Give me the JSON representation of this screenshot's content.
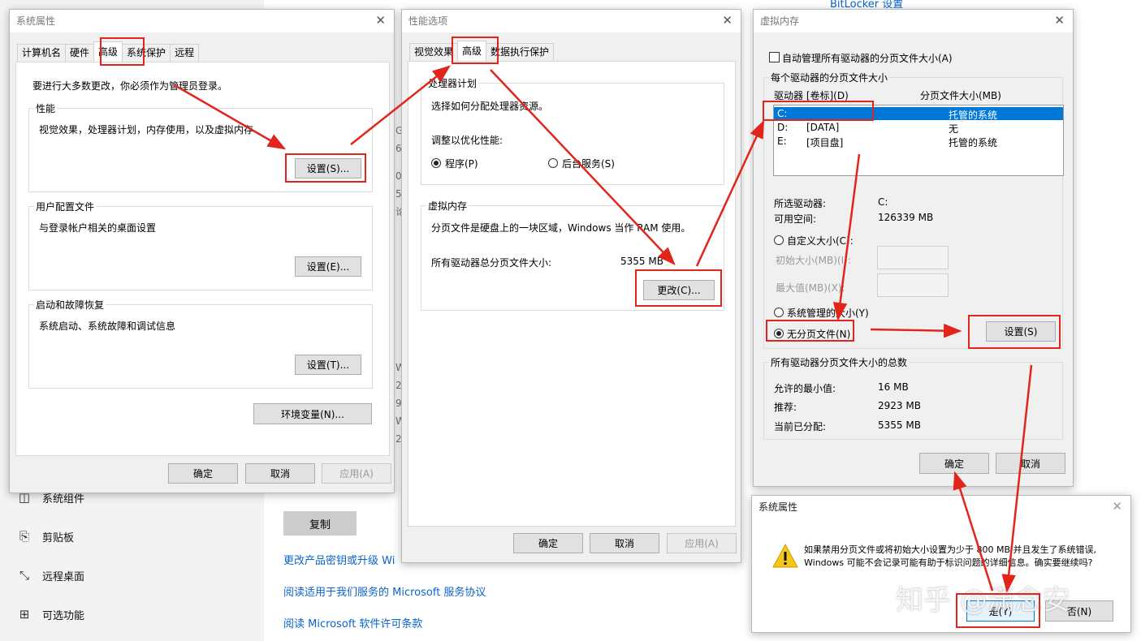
{
  "background": {
    "top_link": "BitLocker 设置",
    "side_items": [
      {
        "icon": "components-icon",
        "label": "系统组件"
      },
      {
        "icon": "clipboard-icon",
        "label": "剪贴板"
      },
      {
        "icon": "remote-desktop-icon",
        "label": "远程桌面"
      },
      {
        "icon": "optional-features-icon",
        "label": "可选功能"
      }
    ],
    "copy_button": "复制",
    "links": [
      "更改产品密钥或升级 Wi",
      "阅读适用于我们服务的 Microsoft 服务协议",
      "阅读 Microsoft 软件许可条款"
    ],
    "peek_chars": [
      "G",
      "6",
      "0",
      "5",
      "论",
      "W",
      "2",
      "9",
      "W",
      "2"
    ]
  },
  "sysprops": {
    "title": "系统属性",
    "tabs": [
      "计算机名",
      "硬件",
      "高级",
      "系统保护",
      "远程"
    ],
    "active_tab": "高级",
    "admin_note": "要进行大多数更改，你必须作为管理员登录。",
    "performance": {
      "label": "性能",
      "desc": "视觉效果，处理器计划，内存使用，以及虚拟内存",
      "button": "设置(S)..."
    },
    "user_profiles": {
      "label": "用户配置文件",
      "desc": "与登录帐户相关的桌面设置",
      "button": "设置(E)..."
    },
    "startup": {
      "label": "启动和故障恢复",
      "desc": "系统启动、系统故障和调试信息",
      "button": "设置(T)..."
    },
    "env_button": "环境变量(N)...",
    "ok": "确定",
    "cancel": "取消",
    "apply": "应用(A)"
  },
  "perf": {
    "title": "性能选项",
    "tabs": [
      "视觉效果",
      "高级",
      "数据执行保护"
    ],
    "active_tab": "高级",
    "cpu": {
      "label": "处理器计划",
      "desc": "选择如何分配处理器资源。",
      "adjust": "调整以优化性能:",
      "programs": "程序(P)",
      "services": "后台服务(S)"
    },
    "vm": {
      "label": "虚拟内存",
      "desc": "分页文件是硬盘上的一块区域，Windows 当作 RAM 使用。",
      "total_label": "所有驱动器总分页文件大小:",
      "total_value": "5355 MB",
      "button": "更改(C)..."
    },
    "ok": "确定",
    "cancel": "取消",
    "apply": "应用(A)"
  },
  "vmdlg": {
    "title": "虚拟内存",
    "auto_manage": "自动管理所有驱动器的分页文件大小(A)",
    "auto_checked": false,
    "group_label": "每个驱动器的分页文件大小",
    "col_drive": "驱动器 [卷标](D)",
    "col_size": "分页文件大小(MB)",
    "drives": [
      {
        "drive": "C:",
        "label": "",
        "size": "托管的系统"
      },
      {
        "drive": "D:",
        "label": "[DATA]",
        "size": "无"
      },
      {
        "drive": "E:",
        "label": "[项目盘]",
        "size": "托管的系统"
      }
    ],
    "selected_label": "所选驱动器:",
    "selected_value": "C:",
    "space_label": "可用空间:",
    "space_value": "126339 MB",
    "custom": "自定义大小(C):",
    "initial": "初始大小(MB)(I):",
    "max": "最大值(MB)(X):",
    "system_managed": "系统管理的大小(Y)",
    "no_paging": "无分页文件(N)",
    "set_button": "设置(S)",
    "totals_label": "所有驱动器分页文件大小的总数",
    "min_label": "允许的最小值:",
    "min_value": "16 MB",
    "rec_label": "推荐:",
    "rec_value": "2923 MB",
    "cur_label": "当前已分配:",
    "cur_value": "5355 MB",
    "ok": "确定",
    "cancel": "取消"
  },
  "confirm": {
    "title": "系统属性",
    "message_1": "如果禁用分页文件或将初始大小设置为少于 800 MB 并且发生了系统错误,",
    "message_2": "Windows 可能不会记录可能有助于标识问题的详细信息。确实要继续吗?",
    "yes": "是(Y)",
    "no": "否(N)"
  },
  "watermark": "知乎 @潇念安",
  "colors": {
    "highlight": "#e1251b",
    "link": "#0a64c8",
    "selection": "#0078d7"
  }
}
